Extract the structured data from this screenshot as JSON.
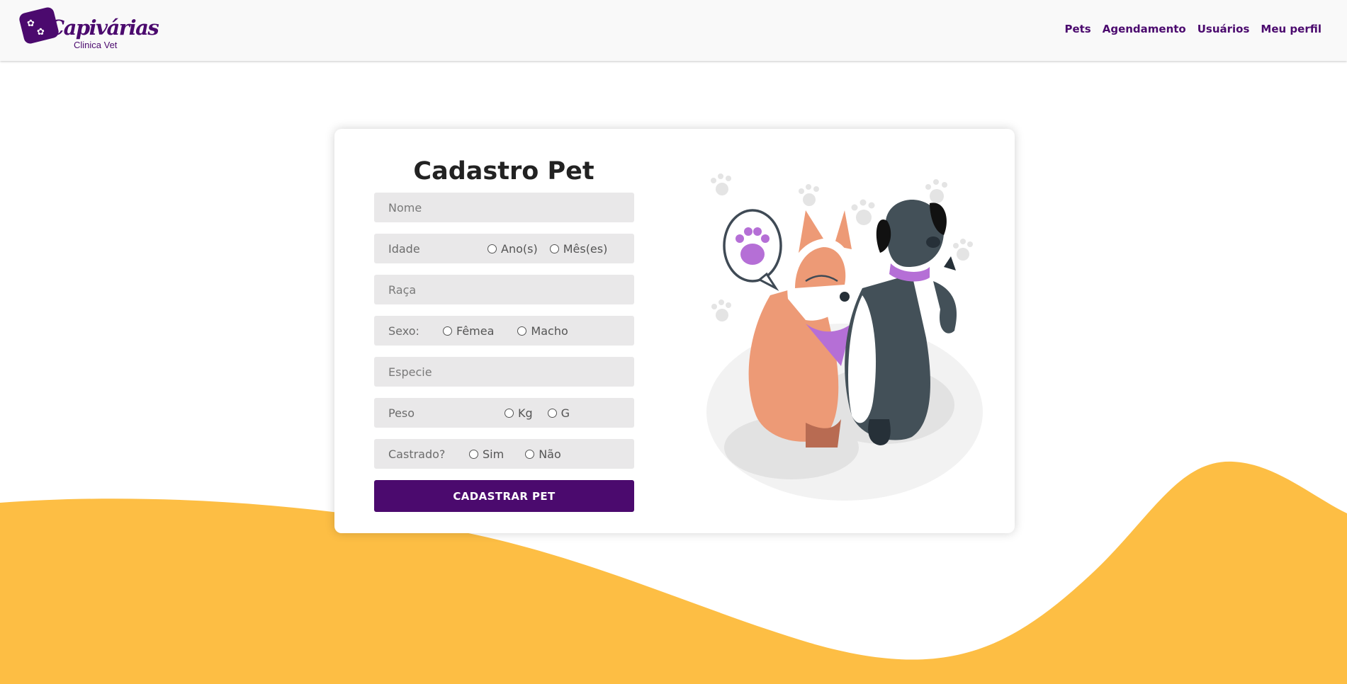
{
  "header": {
    "logo": {
      "name": "Capivárias",
      "subtitle": "Clinica Vet"
    },
    "nav": [
      {
        "label": "Pets"
      },
      {
        "label": "Agendamento"
      },
      {
        "label": "Usuários"
      },
      {
        "label": "Meu perfil"
      }
    ]
  },
  "form": {
    "title": "Cadastro Pet",
    "nome": {
      "placeholder": "Nome"
    },
    "idade": {
      "label": "Idade",
      "options": [
        "Ano(s)",
        "Mês(es)"
      ]
    },
    "raca": {
      "placeholder": "Raça"
    },
    "sexo": {
      "label": "Sexo:",
      "options": [
        "Fêmea",
        "Macho"
      ]
    },
    "especie": {
      "placeholder": "Especie"
    },
    "peso": {
      "label": "Peso",
      "options": [
        "Kg",
        "G"
      ]
    },
    "castrado": {
      "label": "Castrado?",
      "options": [
        "Sim",
        "Não"
      ]
    },
    "submit_label": "CADASTRAR PET"
  },
  "colors": {
    "brand": "#4b0a6e",
    "wave": "#fdbe44",
    "field_bg": "#e9e8e9",
    "accent_purple": "#b56fd6"
  }
}
